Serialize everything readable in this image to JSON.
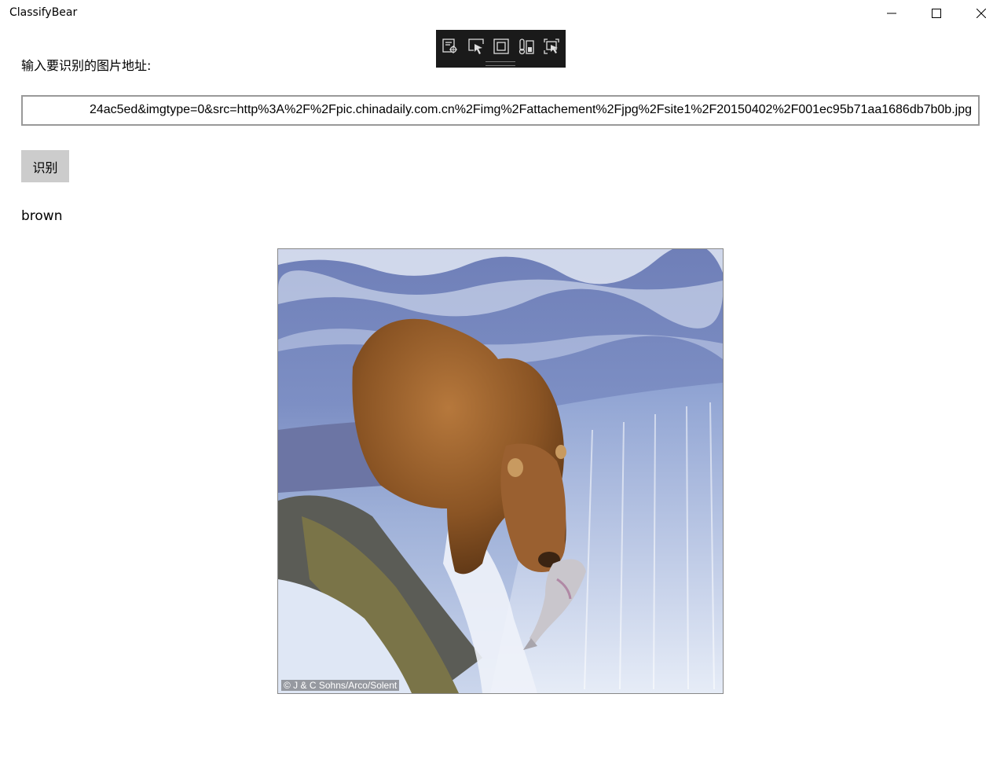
{
  "window": {
    "title": "ClassifyBear"
  },
  "caption": {
    "minimize": "minimize-icon",
    "maximize": "maximize-icon",
    "close": "close-icon"
  },
  "debug_toolbar": {
    "icons": [
      "live-visual-tree-icon",
      "select-element-icon",
      "display-layout-adorners-icon",
      "track-focus-icon",
      "select-element-cursor-icon"
    ]
  },
  "main": {
    "prompt_label": "输入要识别的图片地址:",
    "url_value": "24ac5ed&imgtype=0&src=http%3A%2F%2Fpic.chinadaily.com.cn%2Fimg%2Fattachement%2Fjpg%2Fsite1%2F20150402%2F001ec95b71aa1686db7b0b.jpg",
    "recognize_button": "识别",
    "result": "brown",
    "photo_credit": "© J & C Sohns/Arco/Solent"
  },
  "colors": {
    "button_bg": "#cccccc",
    "toolbar_bg": "#1a1a1a",
    "input_border": "#999999"
  }
}
